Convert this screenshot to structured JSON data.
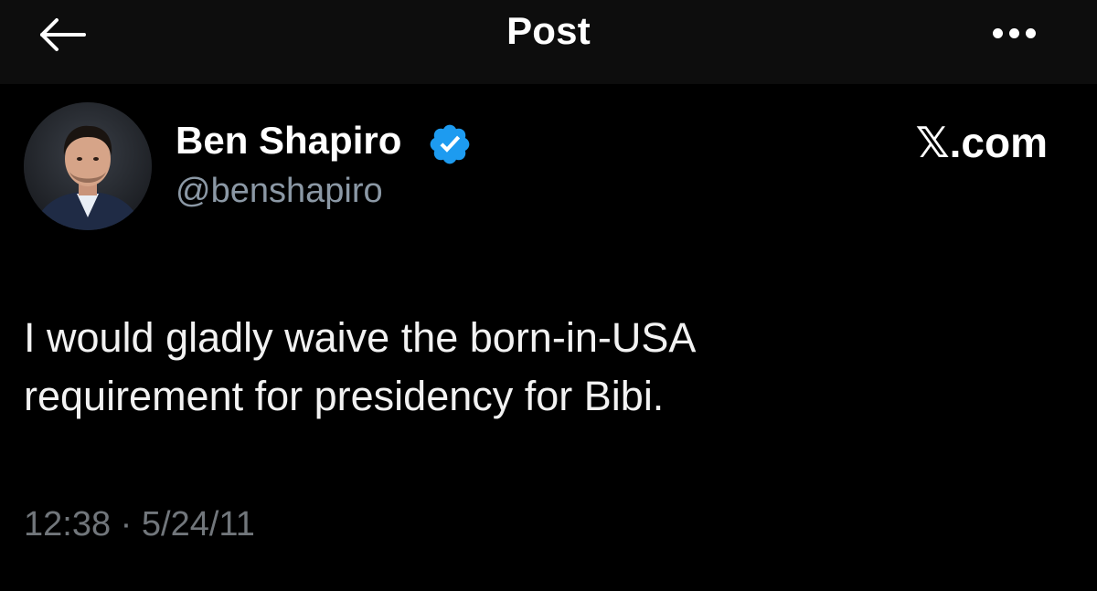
{
  "header": {
    "title": "Post",
    "back_icon": "arrow-left-icon",
    "more_icon": "ellipsis-icon"
  },
  "author": {
    "name": "Ben Shapiro",
    "handle": "@benshapiro",
    "verified": true,
    "verified_color": "#1d9bf0"
  },
  "source": "𝕏.com",
  "post": {
    "lines": [
      "I would gladly waive the born-in-USA",
      "requirement for presidency for Bibi."
    ]
  },
  "meta": {
    "time": "12:38",
    "separator": "·",
    "date": "5/24/11"
  },
  "colors": {
    "background": "#000000",
    "topbar": "#0d0d0d",
    "text": "#ffffff",
    "secondary_text": "#71767b",
    "accent": "#1d9bf0"
  }
}
